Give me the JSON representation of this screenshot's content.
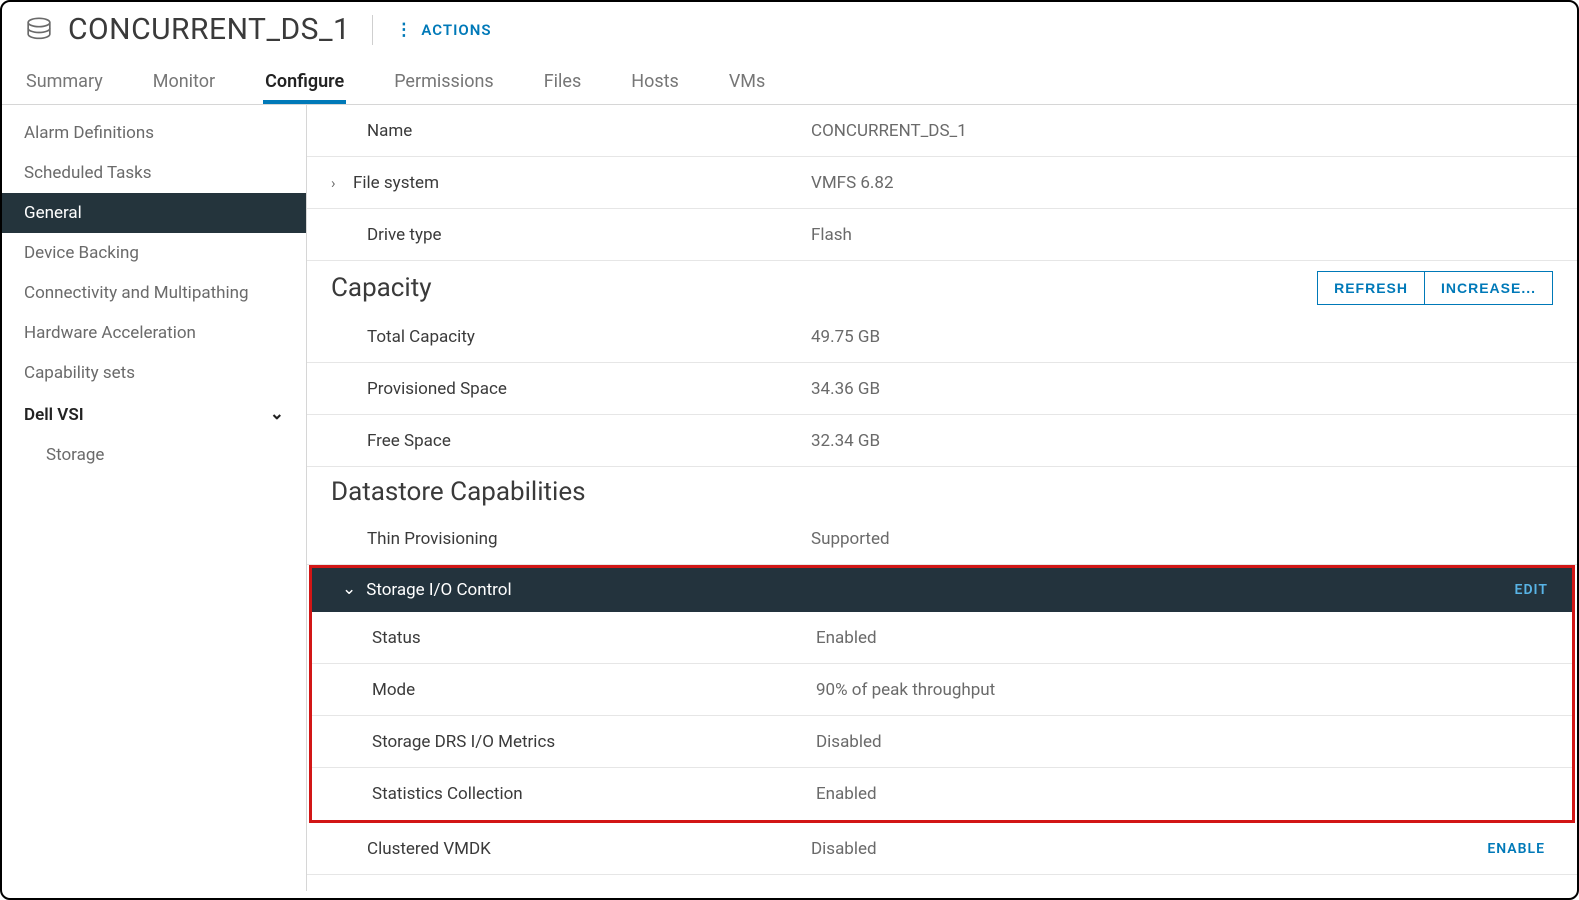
{
  "header": {
    "title": "CONCURRENT_DS_1",
    "actions_label": "ACTIONS"
  },
  "tabs": [
    {
      "label": "Summary",
      "active": false
    },
    {
      "label": "Monitor",
      "active": false
    },
    {
      "label": "Configure",
      "active": true
    },
    {
      "label": "Permissions",
      "active": false
    },
    {
      "label": "Files",
      "active": false
    },
    {
      "label": "Hosts",
      "active": false
    },
    {
      "label": "VMs",
      "active": false
    }
  ],
  "sidebar": {
    "items": [
      {
        "label": "Alarm Definitions"
      },
      {
        "label": "Scheduled Tasks"
      },
      {
        "label": "General",
        "active": true
      },
      {
        "label": "Device Backing"
      },
      {
        "label": "Connectivity and Multipathing"
      },
      {
        "label": "Hardware Acceleration"
      },
      {
        "label": "Capability sets"
      }
    ],
    "group": {
      "label": "Dell VSI"
    },
    "subitems": [
      {
        "label": "Storage"
      }
    ]
  },
  "general": {
    "rows": [
      {
        "label": "Name",
        "value": "CONCURRENT_DS_1"
      },
      {
        "label": "File system",
        "value": "VMFS 6.82",
        "expandable": true
      },
      {
        "label": "Drive type",
        "value": "Flash"
      }
    ]
  },
  "capacity": {
    "title": "Capacity",
    "buttons": {
      "refresh": "REFRESH",
      "increase": "INCREASE..."
    },
    "rows": [
      {
        "label": "Total Capacity",
        "value": "49.75 GB"
      },
      {
        "label": "Provisioned Space",
        "value": "34.36 GB"
      },
      {
        "label": "Free Space",
        "value": "32.34 GB"
      }
    ]
  },
  "capabilities": {
    "title": "Datastore Capabilities",
    "thin": {
      "label": "Thin Provisioning",
      "value": "Supported"
    },
    "sioc": {
      "header": "Storage I/O Control",
      "edit_label": "EDIT",
      "rows": [
        {
          "label": "Status",
          "value": "Enabled"
        },
        {
          "label": "Mode",
          "value": "90% of peak throughput"
        },
        {
          "label": "Storage DRS I/O Metrics",
          "value": "Disabled"
        },
        {
          "label": "Statistics Collection",
          "value": "Enabled"
        }
      ]
    },
    "clustered": {
      "label": "Clustered VMDK",
      "value": "Disabled",
      "action": "ENABLE"
    }
  }
}
